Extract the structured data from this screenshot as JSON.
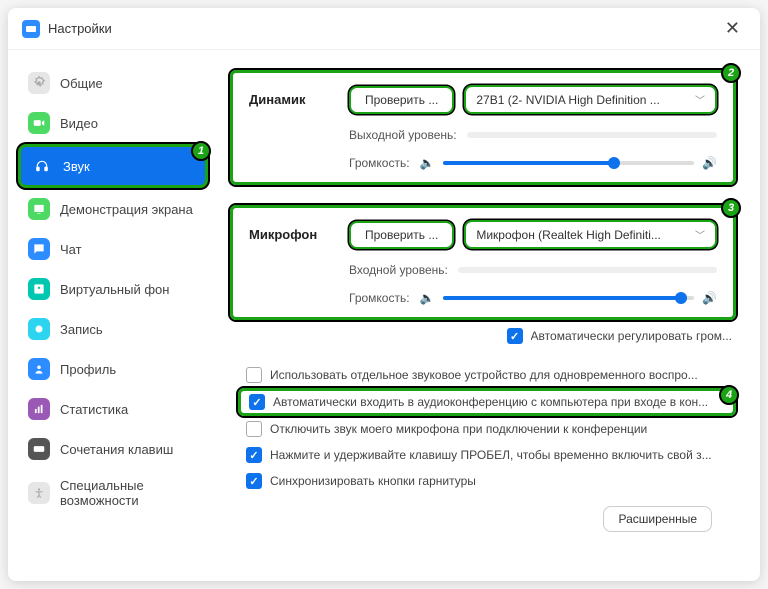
{
  "window": {
    "title": "Настройки"
  },
  "sidebar": {
    "items": [
      {
        "label": "Общие"
      },
      {
        "label": "Видео"
      },
      {
        "label": "Звук"
      },
      {
        "label": "Демонстрация экрана"
      },
      {
        "label": "Чат"
      },
      {
        "label": "Виртуальный фон"
      },
      {
        "label": "Запись"
      },
      {
        "label": "Профиль"
      },
      {
        "label": "Статистика"
      },
      {
        "label": "Сочетания клавиш"
      },
      {
        "label": "Специальные возможности"
      }
    ]
  },
  "speaker": {
    "title": "Динамик",
    "test_btn": "Проверить ...",
    "device": "27B1 (2- NVIDIA High Definition ...",
    "output_level": "Выходной уровень:",
    "volume_label": "Громкость:",
    "volume_percent": 68
  },
  "mic": {
    "title": "Микрофон",
    "test_btn": "Проверить ...",
    "device": "Микрофон (Realtek High Definiti...",
    "input_level": "Входной уровень:",
    "volume_label": "Громкость:",
    "volume_percent": 95,
    "auto_adjust": "Автоматически регулировать гром..."
  },
  "options": {
    "separate_device": "Использовать отдельное звуковое устройство для одновременного воспро...",
    "auto_join_audio": "Автоматически входить в аудиоконференцию с компьютера при входе в кон...",
    "mute_on_join": "Отключить звук моего микрофона при подключении к конференции",
    "push_to_talk": "Нажмите и удерживайте клавишу ПРОБЕЛ, чтобы временно включить свой з...",
    "sync_headset": "Синхронизировать кнопки гарнитуры"
  },
  "advanced_btn": "Расширенные",
  "badges": {
    "b1": "1",
    "b2": "2",
    "b3": "3",
    "b4": "4"
  }
}
